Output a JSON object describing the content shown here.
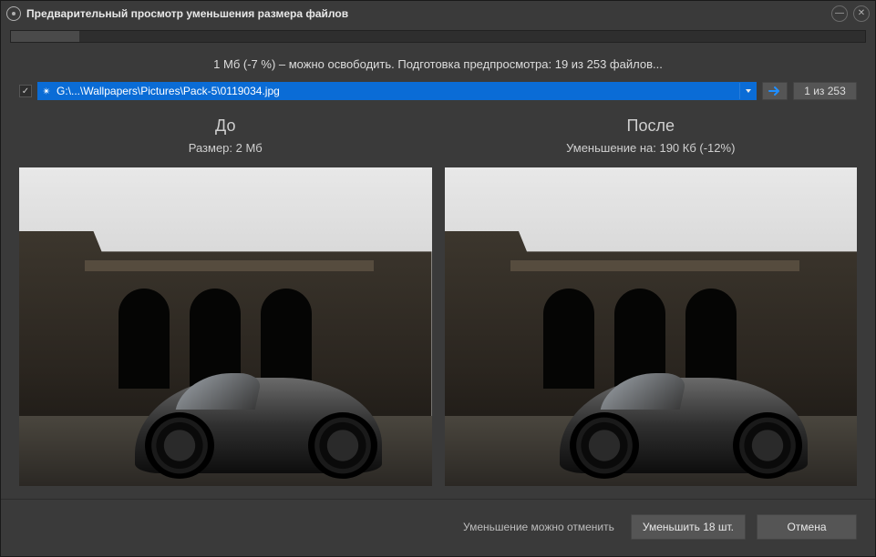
{
  "window": {
    "title": "Предварительный просмотр уменьшения размера файлов"
  },
  "progress": {
    "status_text": "1 Мб (-7 %) – можно освободить. Подготовка предпросмотра: 19 из 253 файлов...",
    "percent": 7
  },
  "pathbar": {
    "checked": true,
    "file_path": "G:\\...\\Wallpapers\\Pictures\\Pack-5\\0119034.jpg",
    "counter": "1 из 253"
  },
  "before": {
    "title": "До",
    "subtitle": "Размер: 2 Мб"
  },
  "after": {
    "title": "После",
    "subtitle": "Уменьшение на: 190 Кб (-12%)"
  },
  "footer": {
    "hint": "Уменьшение можно отменить",
    "do_label": "Уменьшить 18 шт.",
    "cancel_label": "Отмена"
  }
}
